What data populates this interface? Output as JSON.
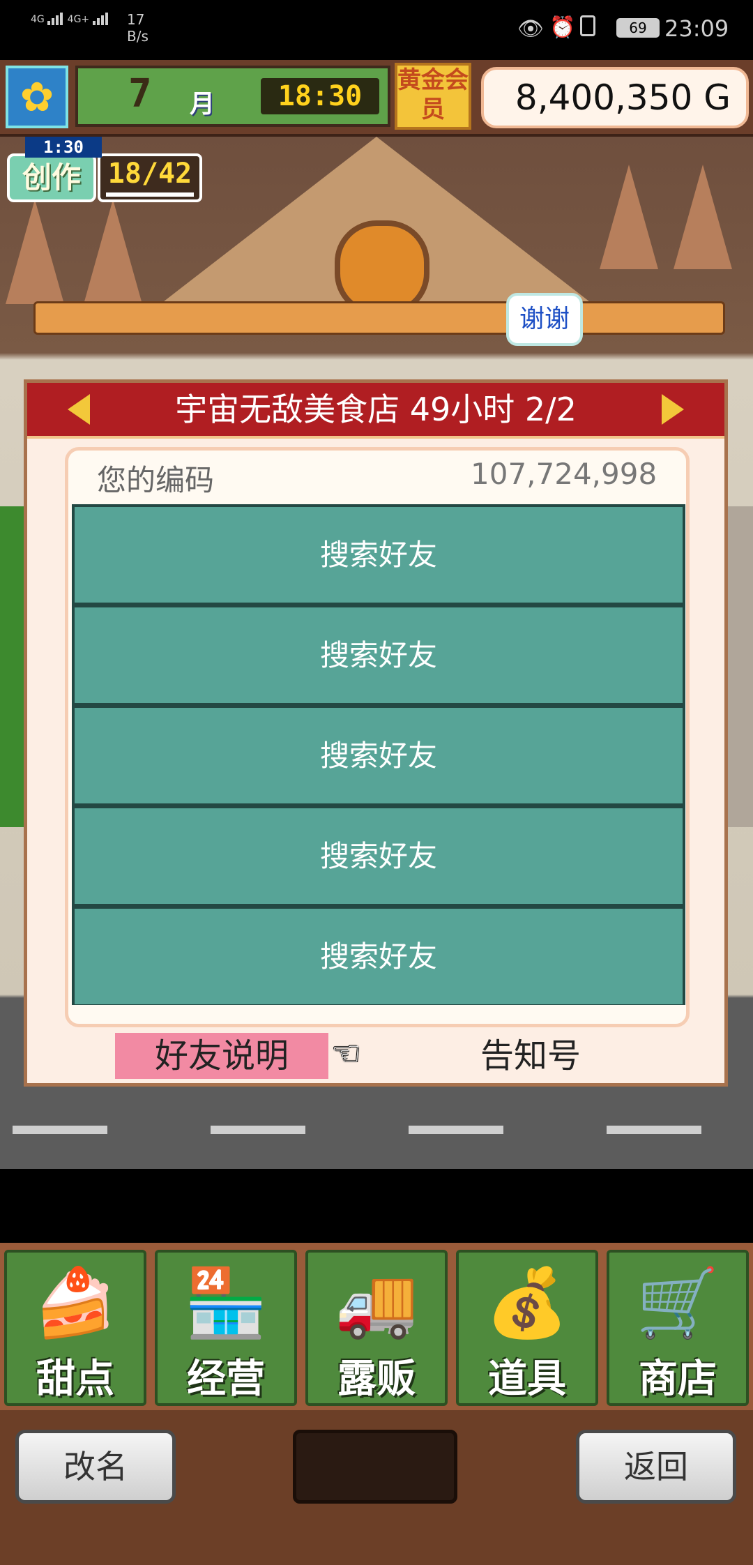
{
  "status_bar": {
    "network_1": "4G",
    "network_2": "4G+",
    "speed": "17",
    "speed_unit": "B/s",
    "battery": "69",
    "time": "23:09"
  },
  "hud": {
    "month_value": "7",
    "month_label": "月",
    "clock": "18:30",
    "gold_member": "黄金会员",
    "money": "8,400,350 G"
  },
  "create": {
    "timer": "1:30",
    "label": "创作",
    "count": "18/42"
  },
  "thanks_bubble": "谢谢",
  "dialog": {
    "title": "宇宙无敌美食店  49小时 2/2",
    "code_label": "您的编码",
    "code_value": "107,724,998",
    "search_buttons": [
      "搜索好友",
      "搜索好友",
      "搜索好友",
      "搜索好友",
      "搜索好友"
    ],
    "friend_help": "好友说明",
    "notice": "告知号"
  },
  "menu": {
    "items": [
      {
        "label": "甜点",
        "icon": "cake-icon"
      },
      {
        "label": "经营",
        "icon": "shop-icon"
      },
      {
        "label": "露贩",
        "icon": "food-truck-icon"
      },
      {
        "label": "道具",
        "icon": "items-bag-icon"
      },
      {
        "label": "商店",
        "icon": "shopping-cart-icon"
      }
    ]
  },
  "bottom": {
    "rename": "改名",
    "back": "返回"
  }
}
